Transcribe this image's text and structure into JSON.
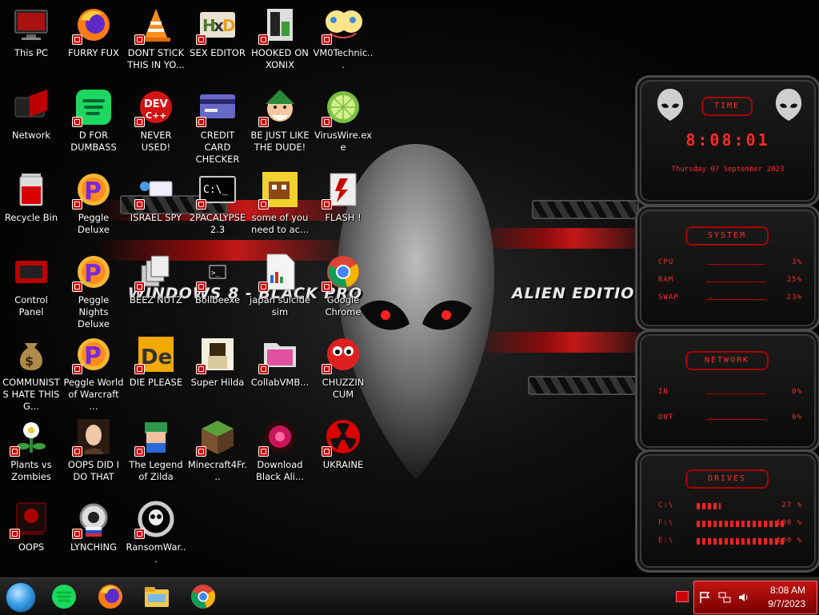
{
  "wallpaper": {
    "text_left": "WINDOWS 8 - BLACK PRO",
    "text_right": "ALIEN EDITION 20"
  },
  "desktop_icons": [
    {
      "label": "This PC",
      "icon": "monitor-icon"
    },
    {
      "label": "FURRY FUX",
      "icon": "firefox-icon"
    },
    {
      "label": "DONT STICK THIS IN YO...",
      "icon": "vlc-cone-icon"
    },
    {
      "label": "SEX EDITOR",
      "icon": "hex-editor-icon"
    },
    {
      "label": "HOOKED ON XONIX",
      "icon": "xonix-icon"
    },
    {
      "label": "VM0Technic...",
      "icon": "cartoon-faces-icon"
    },
    {
      "label": "Network",
      "icon": "network-icon"
    },
    {
      "label": "D FOR DUMBASS",
      "icon": "spotify-icon"
    },
    {
      "label": "NEVER USED!",
      "icon": "devcpp-icon"
    },
    {
      "label": "CREDIT CARD CHECKER",
      "icon": "credit-card-icon"
    },
    {
      "label": "BE JUST LIKE THE DUDE!",
      "icon": "elf-icon"
    },
    {
      "label": "VirusWire.exe",
      "icon": "lime-icon"
    },
    {
      "label": "Recycle Bin",
      "icon": "recycle-bin-icon"
    },
    {
      "label": "Peggle Deluxe",
      "icon": "peggle-icon"
    },
    {
      "label": "ISRAEL SPY",
      "icon": "spy-icon"
    },
    {
      "label": "2PACALYPSE 2.3",
      "icon": "terminal-icon"
    },
    {
      "label": "some of you need to ac...",
      "icon": "pixel-dog-icon"
    },
    {
      "label": "FLASH !",
      "icon": "flash-icon"
    },
    {
      "label": "Control Panel",
      "icon": "control-panel-icon"
    },
    {
      "label": "Peggle Nights Deluxe",
      "icon": "peggle-icon"
    },
    {
      "label": "BEEZ NUTZ",
      "icon": "stacked-windows-icon"
    },
    {
      "label": "Bollbeexe",
      "icon": "console-icon"
    },
    {
      "label": "japan suicide sim",
      "icon": "document-icon"
    },
    {
      "label": "Google Chrome",
      "icon": "chrome-icon"
    },
    {
      "label": "COMMUNISTS HATE THIS G...",
      "icon": "money-bag-icon"
    },
    {
      "label": "Peggle World of Warcraft ...",
      "icon": "peggle-icon"
    },
    {
      "label": "DIE PLEASE",
      "icon": "die-icon"
    },
    {
      "label": "Super Hilda",
      "icon": "pixel-character-icon"
    },
    {
      "label": "CollabVMB...",
      "icon": "pink-folder-icon"
    },
    {
      "label": "CHUZZIN CUM",
      "icon": "chuzzle-icon"
    },
    {
      "label": "Plants vs Zombies",
      "icon": "plant-icon"
    },
    {
      "label": "OOPS DID I DO THAT",
      "icon": "portrait-icon"
    },
    {
      "label": "The Legend of Zilda",
      "icon": "zilda-icon"
    },
    {
      "label": "Minecraft4Fr...",
      "icon": "grass-block-icon"
    },
    {
      "label": "Download Black Ali...",
      "icon": "alien-orb-icon"
    },
    {
      "label": "UKRAINE",
      "icon": "radiation-icon"
    },
    {
      "label": "OOPS",
      "icon": "red-box-icon"
    },
    {
      "label": "LYNCHING",
      "icon": "gear-flag-icon"
    },
    {
      "label": "RansomWar...",
      "icon": "skull-ring-icon"
    }
  ],
  "gadgets": {
    "time": {
      "title": "TIME",
      "time": "8:08:01",
      "date": "Thursday 07 September 2023"
    },
    "system": {
      "title": "SYSTEM",
      "rows": [
        {
          "label": "CPU",
          "value": "3%"
        },
        {
          "label": "RAM",
          "value": "25%"
        },
        {
          "label": "SWAP",
          "value": "23%"
        }
      ]
    },
    "network": {
      "title": "NETWORK",
      "rows": [
        {
          "label": "IN",
          "value": "0%"
        },
        {
          "label": "OUT",
          "value": "0%"
        }
      ]
    },
    "drives": {
      "title": "DRIVES",
      "rows": [
        {
          "label": "C:\\",
          "value": "27 %",
          "level": 0.27
        },
        {
          "label": "F:\\",
          "value": "100 %",
          "level": 1.0
        },
        {
          "label": "E:\\",
          "value": "100 %",
          "level": 1.0
        }
      ]
    }
  },
  "taskbar": {
    "pinned": [
      "spotify-icon",
      "firefox-icon",
      "file-explorer-icon",
      "chrome-icon"
    ],
    "clock_time": "8:08 AM",
    "clock_date": "9/7/2023"
  }
}
